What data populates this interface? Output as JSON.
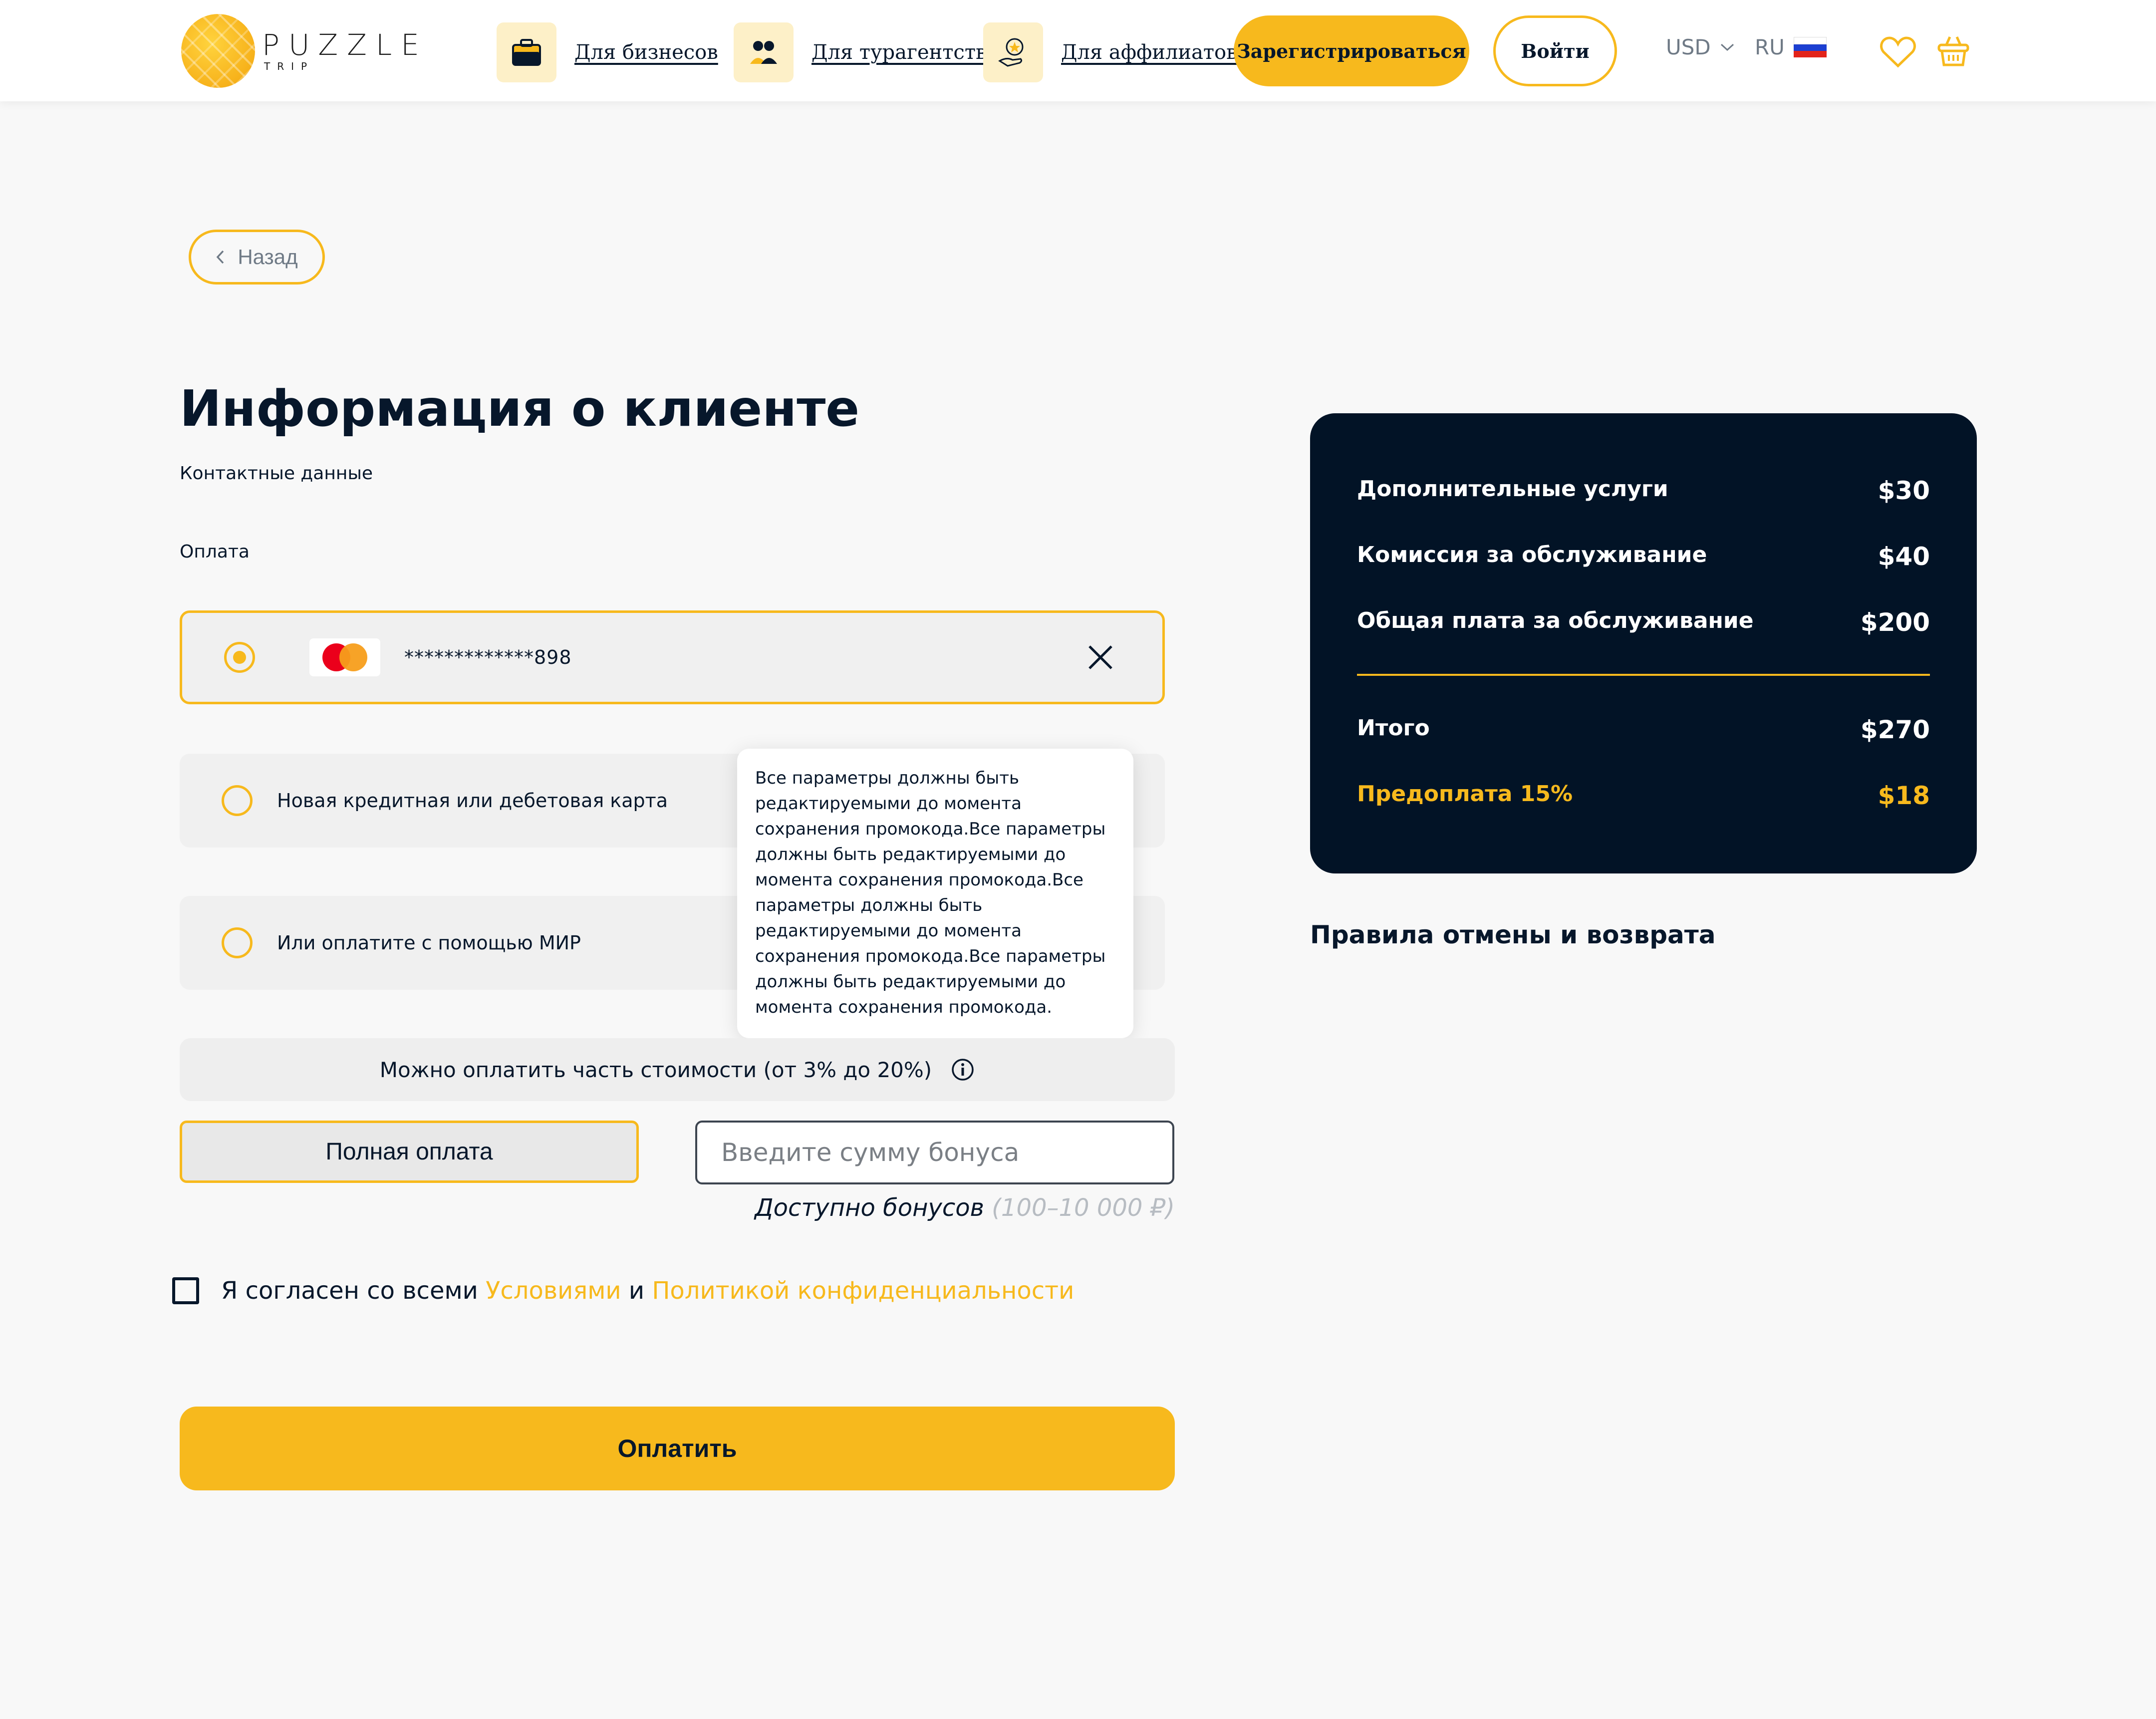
{
  "header": {
    "logo": {
      "word": "PUZZLE",
      "sub": "TRIP"
    },
    "nav": [
      {
        "label": "Для бизнесов"
      },
      {
        "label": "Для турагентств"
      },
      {
        "label": "Для аффилиатов"
      }
    ],
    "register_label": "Зарегистрироваться",
    "login_label": "Войти",
    "currency": "USD",
    "language": "RU",
    "colors": {
      "accent": "#f7b91d",
      "dark": "#021326"
    }
  },
  "back_label": "Назад",
  "page": {
    "title": "Информация о клиенте",
    "subtitle": "Контактные данные",
    "payment_label": "Оплата"
  },
  "payment_options": {
    "saved_card": {
      "number": "*************898",
      "selected": true
    },
    "new_card": "Новая кредитная или дебетовая карта",
    "mir": "Или оплатите с помощью МИР"
  },
  "tooltip_text": "Все параметры должны быть редактируемыми до момента сохранения промокода.Все параметры должны быть редактируемыми до момента сохранения промокода.Все параметры должны быть редактируемыми до момента сохранения промокода.Все параметры должны быть редактируемыми до момента сохранения промокода.",
  "partial_payment": "Можно оплатить часть стоимости (от 3% до 20%)",
  "full_payment_label": "Полная оплата",
  "bonus": {
    "placeholder": "Введите сумму бонуса",
    "available_label": "Доступно бонусов",
    "range": "(100–10 000 ₽)"
  },
  "agreement": {
    "prefix": "Я согласен со всеми",
    "terms": "Условиями",
    "and": "и",
    "privacy": "Политикой конфиденциальности"
  },
  "pay_label": "Оплатить",
  "summary": {
    "rows": [
      {
        "label": "Дополнительные услуги",
        "value": "$30"
      },
      {
        "label": "Комиссия за обслуживание",
        "value": "$40"
      },
      {
        "label": "Общая плата за обслуживание",
        "value": "$200"
      }
    ],
    "total": {
      "label": "Итого",
      "value": "$270"
    },
    "prepay": {
      "label": "Предоплата 15%",
      "value": "$18"
    }
  },
  "rules_title": "Правила отмены и возврата"
}
